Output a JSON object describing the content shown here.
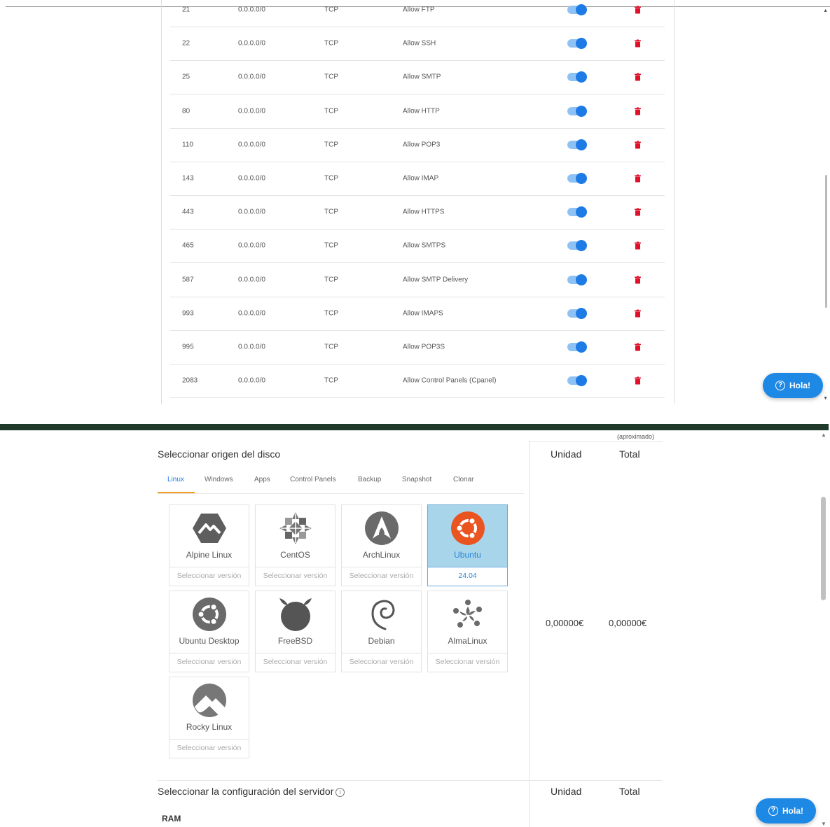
{
  "firewall": {
    "rules": [
      {
        "port": "21",
        "source": "0.0.0.0/0",
        "protocol": "TCP",
        "description": "Allow FTP",
        "enabled": true
      },
      {
        "port": "22",
        "source": "0.0.0.0/0",
        "protocol": "TCP",
        "description": "Allow SSH",
        "enabled": true
      },
      {
        "port": "25",
        "source": "0.0.0.0/0",
        "protocol": "TCP",
        "description": "Allow SMTP",
        "enabled": true
      },
      {
        "port": "80",
        "source": "0.0.0.0/0",
        "protocol": "TCP",
        "description": "Allow HTTP",
        "enabled": true
      },
      {
        "port": "110",
        "source": "0.0.0.0/0",
        "protocol": "TCP",
        "description": "Allow POP3",
        "enabled": true
      },
      {
        "port": "143",
        "source": "0.0.0.0/0",
        "protocol": "TCP",
        "description": "Allow IMAP",
        "enabled": true
      },
      {
        "port": "443",
        "source": "0.0.0.0/0",
        "protocol": "TCP",
        "description": "Allow HTTPS",
        "enabled": true
      },
      {
        "port": "465",
        "source": "0.0.0.0/0",
        "protocol": "TCP",
        "description": "Allow SMTPS",
        "enabled": true
      },
      {
        "port": "587",
        "source": "0.0.0.0/0",
        "protocol": "TCP",
        "description": "Allow SMTP Delivery",
        "enabled": true
      },
      {
        "port": "993",
        "source": "0.0.0.0/0",
        "protocol": "TCP",
        "description": "Allow IMAPS",
        "enabled": true
      },
      {
        "port": "995",
        "source": "0.0.0.0/0",
        "protocol": "TCP",
        "description": "Allow POP3S",
        "enabled": true
      },
      {
        "port": "2083",
        "source": "0.0.0.0/0",
        "protocol": "TCP",
        "description": "Allow Control Panels (Cpanel)",
        "enabled": true
      }
    ]
  },
  "chat": {
    "label": "Hola!"
  },
  "disk": {
    "approx_note": "(aproximado)",
    "title": "Seleccionar origen del disco",
    "unit_header": "Unidad",
    "total_header": "Total",
    "unit_price": "0,00000€",
    "total_price": "0,00000€",
    "tabs": [
      "Linux",
      "Windows",
      "Apps",
      "Control Panels",
      "Backup",
      "Snapshot",
      "Clonar"
    ],
    "active_tab": "Linux",
    "os_options": [
      {
        "name": "Alpine Linux",
        "version": "Seleccionar versión",
        "selected": false,
        "icon": "alpine-linux-logo-icon"
      },
      {
        "name": "CentOS",
        "version": "Seleccionar versión",
        "selected": false,
        "icon": "centos-logo-icon"
      },
      {
        "name": "ArchLinux",
        "version": "Seleccionar versión",
        "selected": false,
        "icon": "archlinux-logo-icon"
      },
      {
        "name": "Ubuntu",
        "version": "24.04",
        "selected": true,
        "icon": "ubuntu-logo-icon"
      },
      {
        "name": "Ubuntu Desktop",
        "version": "Seleccionar versión",
        "selected": false,
        "icon": "ubuntu-desktop-logo-icon"
      },
      {
        "name": "FreeBSD",
        "version": "Seleccionar versión",
        "selected": false,
        "icon": "freebsd-logo-icon"
      },
      {
        "name": "Debian",
        "version": "Seleccionar versión",
        "selected": false,
        "icon": "debian-logo-icon"
      },
      {
        "name": "AlmaLinux",
        "version": "Seleccionar versión",
        "selected": false,
        "icon": "almalinux-logo-icon"
      },
      {
        "name": "Rocky Linux",
        "version": "Seleccionar versión",
        "selected": false,
        "icon": "rocky-linux-logo-icon"
      }
    ]
  },
  "server_config": {
    "title": "Seleccionar la configuración del servidor",
    "unit_header": "Unidad",
    "total_header": "Total",
    "ram_label": "RAM"
  },
  "colors": {
    "accent": "#1e7be6",
    "tab_underline": "#f0a020",
    "delete": "#e0102a",
    "selected_card": "#a9d5ea",
    "separator": "#1f3a2a"
  }
}
